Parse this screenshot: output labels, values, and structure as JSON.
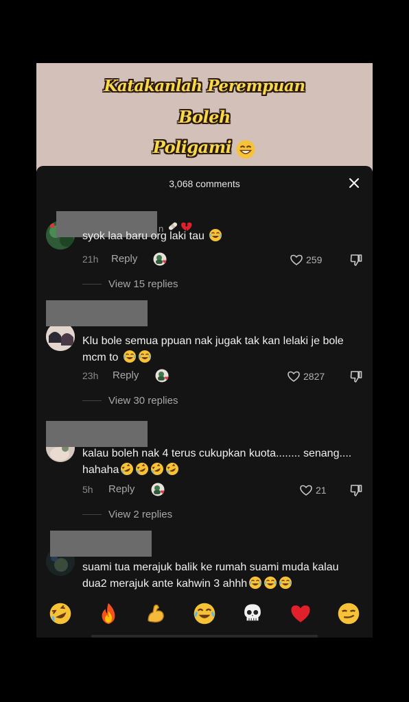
{
  "video_preview": {
    "caption_lines": [
      "Katakanlah Perempuan",
      "Boleh",
      "Poligami"
    ],
    "caption_emoji": "grinning-face"
  },
  "sheet": {
    "title": "3,068 comments"
  },
  "comments": [
    {
      "username_suffix": "n",
      "text": "syok laa baru org laki tau",
      "text_emoji": "tears-of-joy",
      "time": "21h",
      "reply_label": "Reply",
      "likes": "259",
      "view_replies": "View 15 replies"
    },
    {
      "text": "Klu bole semua ppuan nak jugak tak kan lelaki je bole mcm to",
      "text_emoji": "tears-of-joy x2",
      "time": "23h",
      "reply_label": "Reply",
      "likes": "2827",
      "view_replies": "View 30 replies"
    },
    {
      "text": "kalau boleh nak 4 terus cukupkan kuota........ senang.... hahaha",
      "text_emoji": "rolling-on-floor-laughing x4",
      "time": "5h",
      "reply_label": "Reply",
      "likes": "21",
      "view_replies": "View 2 replies"
    },
    {
      "text": "suami tua merajuk balik ke rumah suami muda kalau dua2 merajuk ante kahwin 3 ahhh",
      "text_emoji": "tears-of-joy x3"
    }
  ],
  "emoji_bar": [
    "rolling-on-floor-laughing",
    "fire",
    "flexed-biceps",
    "tears-of-joy",
    "skull",
    "red-heart",
    "smirking-face"
  ],
  "colors": {
    "background": "#161616",
    "banner": "#d3c0b9",
    "caption": "#f7d84a",
    "muted_text": "#a8a8a8"
  }
}
